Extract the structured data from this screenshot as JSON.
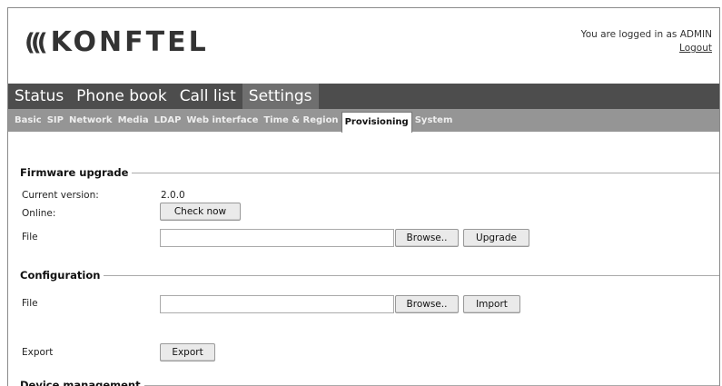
{
  "brand": {
    "logo_waves": "(((",
    "logo_text": "KONFTEL"
  },
  "login": {
    "text": "You are logged in as ADMIN",
    "logout": "Logout"
  },
  "main_nav": [
    "Status",
    "Phone book",
    "Call list",
    "Settings"
  ],
  "main_nav_active": "Settings",
  "sub_nav": [
    "Basic",
    "SIP",
    "Network",
    "Media",
    "LDAP",
    "Web interface",
    "Time & Region",
    "Provisioning",
    "System"
  ],
  "sub_nav_active": "Provisioning",
  "firmware": {
    "title": "Firmware upgrade",
    "current_version_label": "Current version:",
    "current_version_value": "2.0.0",
    "online_label": "Online:",
    "check_now": "Check now",
    "file_label": "File",
    "file_value": "",
    "browse": "Browse..",
    "upgrade": "Upgrade"
  },
  "configuration": {
    "title": "Configuration",
    "file_label": "File",
    "file_value": "",
    "browse": "Browse..",
    "import": "Import",
    "export_label": "Export",
    "export": "Export"
  },
  "device_management": {
    "title": "Device management"
  }
}
